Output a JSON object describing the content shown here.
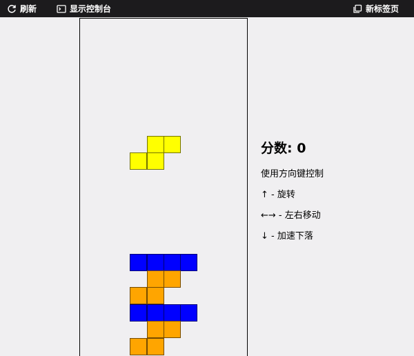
{
  "toolbar": {
    "refresh_label": "刷新",
    "console_label": "显示控制台",
    "newtab_label": "新标签页",
    "icons": {
      "refresh": "refresh-icon",
      "console": "terminal-icon",
      "newtab": "new-tab-icon"
    }
  },
  "game": {
    "grid": {
      "columns": 10,
      "rows": 20
    },
    "colors": {
      "yellow": "#ffff00",
      "blue": "#0000ff",
      "orange": "#ffa500",
      "background": "#f0eff1"
    },
    "falling_piece": {
      "color": "#ffff00",
      "cells": [
        [
          4,
          7
        ],
        [
          5,
          7
        ],
        [
          3,
          8
        ],
        [
          4,
          8
        ]
      ]
    },
    "locked_cells": [
      {
        "c": 3,
        "r": 14,
        "color": "#0000ff"
      },
      {
        "c": 4,
        "r": 14,
        "color": "#0000ff"
      },
      {
        "c": 5,
        "r": 14,
        "color": "#0000ff"
      },
      {
        "c": 6,
        "r": 14,
        "color": "#0000ff"
      },
      {
        "c": 4,
        "r": 15,
        "color": "#ffa500"
      },
      {
        "c": 5,
        "r": 15,
        "color": "#ffa500"
      },
      {
        "c": 3,
        "r": 16,
        "color": "#ffa500"
      },
      {
        "c": 4,
        "r": 16,
        "color": "#ffa500"
      },
      {
        "c": 3,
        "r": 17,
        "color": "#0000ff"
      },
      {
        "c": 4,
        "r": 17,
        "color": "#0000ff"
      },
      {
        "c": 5,
        "r": 17,
        "color": "#0000ff"
      },
      {
        "c": 6,
        "r": 17,
        "color": "#0000ff"
      },
      {
        "c": 4,
        "r": 18,
        "color": "#ffa500"
      },
      {
        "c": 5,
        "r": 18,
        "color": "#ffa500"
      },
      {
        "c": 3,
        "r": 19,
        "color": "#ffa500"
      },
      {
        "c": 4,
        "r": 19,
        "color": "#ffa500"
      }
    ]
  },
  "info": {
    "score_label": "分数: 0",
    "instructions_title": "使用方向键控制",
    "rotate": "↑ - 旋转",
    "move": "←→ - 左右移动",
    "drop": "↓ - 加速下落"
  }
}
